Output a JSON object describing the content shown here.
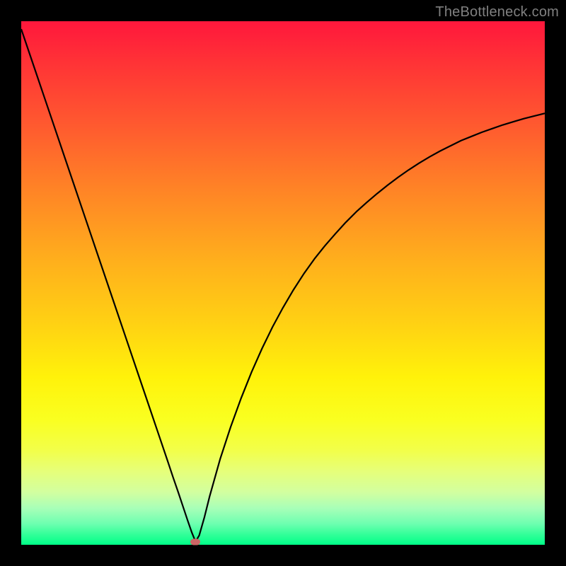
{
  "watermark": "TheBottleneck.com",
  "chart_data": {
    "type": "line",
    "title": "",
    "xlabel": "",
    "ylabel": "",
    "xlim": [
      0,
      1
    ],
    "ylim": [
      0,
      1
    ],
    "grid": false,
    "x": [
      0.0,
      0.02,
      0.04,
      0.06,
      0.08,
      0.1,
      0.12,
      0.14,
      0.16,
      0.18,
      0.2,
      0.22,
      0.24,
      0.26,
      0.28,
      0.29,
      0.3,
      0.31,
      0.318,
      0.326,
      0.333,
      0.34,
      0.35,
      0.36,
      0.38,
      0.4,
      0.42,
      0.44,
      0.46,
      0.48,
      0.5,
      0.52,
      0.54,
      0.56,
      0.58,
      0.6,
      0.62,
      0.64,
      0.66,
      0.68,
      0.7,
      0.72,
      0.74,
      0.76,
      0.78,
      0.8,
      0.82,
      0.84,
      0.86,
      0.88,
      0.9,
      0.92,
      0.94,
      0.96,
      0.98,
      1.0
    ],
    "y": [
      0.985,
      0.926,
      0.867,
      0.808,
      0.749,
      0.69,
      0.631,
      0.572,
      0.513,
      0.454,
      0.395,
      0.336,
      0.277,
      0.218,
      0.159,
      0.129,
      0.1,
      0.07,
      0.046,
      0.023,
      0.006,
      0.018,
      0.053,
      0.093,
      0.164,
      0.225,
      0.28,
      0.33,
      0.375,
      0.416,
      0.453,
      0.487,
      0.518,
      0.546,
      0.571,
      0.594,
      0.616,
      0.636,
      0.654,
      0.671,
      0.687,
      0.702,
      0.716,
      0.729,
      0.741,
      0.752,
      0.762,
      0.772,
      0.78,
      0.788,
      0.795,
      0.802,
      0.808,
      0.814,
      0.819,
      0.824
    ],
    "min_point": {
      "x": 0.333,
      "y": 0.006
    },
    "background_gradient": {
      "direction": "vertical",
      "top_color": "#ff173c",
      "bottom_color": "#00ff88",
      "description": "red (high bottleneck) at top through orange/yellow to green (low bottleneck) at bottom"
    },
    "curve_description": "V-shaped bottleneck curve; steep linear descent from top-left to a minimum near x≈0.33, then concave-down rise toward upper-right",
    "marker": {
      "color": "#cc6666",
      "shape": "rounded-pill",
      "position_note": "placed at the curve minimum"
    }
  }
}
